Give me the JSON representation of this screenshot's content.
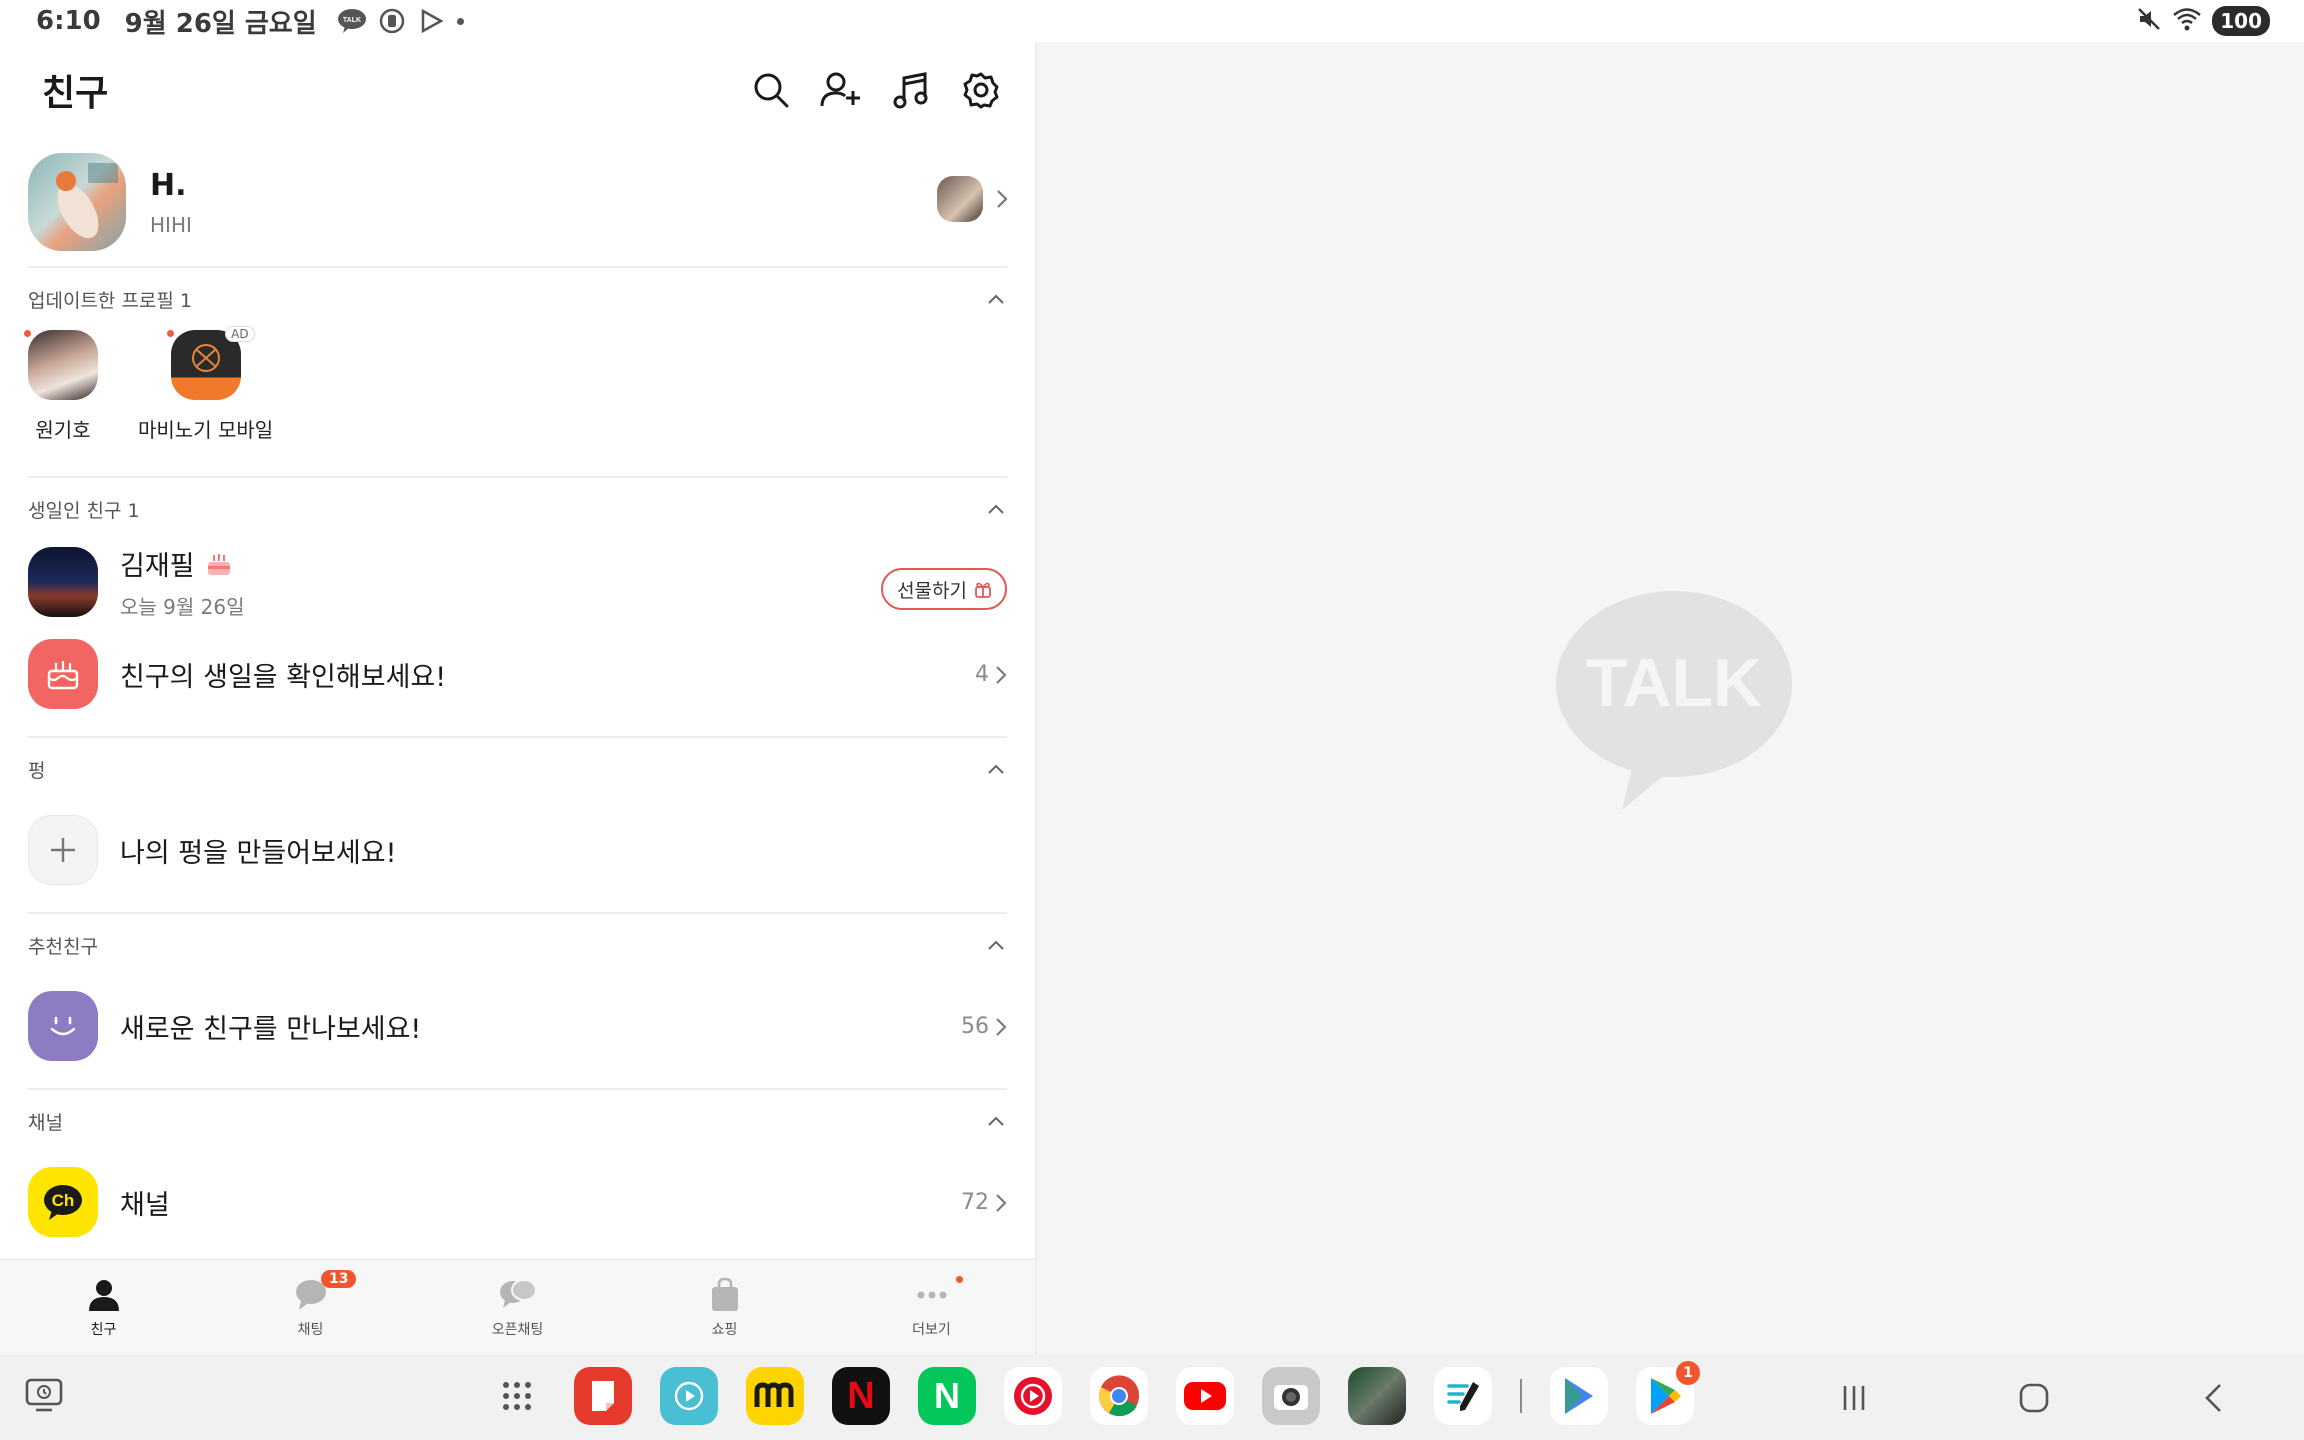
{
  "status_bar": {
    "time": "6:10",
    "date": "9월 26일 금요일",
    "talk_badge": "TALK",
    "battery": "100"
  },
  "header": {
    "title": "친구"
  },
  "profile": {
    "name": "H.",
    "status": "HIHI"
  },
  "sections": {
    "updated": {
      "title": "업데이트한 프로필 1",
      "items": [
        {
          "name": "원기호"
        },
        {
          "name": "마비노기 모바일",
          "badge": "AD"
        }
      ]
    },
    "birthday": {
      "title": "생일인 친구 1",
      "friend": {
        "name": "김재필",
        "date": "오늘 9월 26일",
        "gift_label": "선물하기"
      },
      "check": {
        "label": "친구의 생일을 확인해보세요!",
        "count": "4"
      }
    },
    "pyeong": {
      "title": "펑",
      "create_label": "나의 펑을 만들어보세요!"
    },
    "recommend": {
      "title": "추천친구",
      "label": "새로운 친구를 만나보세요!",
      "count": "56"
    },
    "channel": {
      "title": "채널",
      "label": "채널",
      "icon_text": "Ch",
      "count": "72"
    }
  },
  "bottom_nav": {
    "items": [
      {
        "label": "친구"
      },
      {
        "label": "채팅",
        "badge": "13"
      },
      {
        "label": "오픈채팅"
      },
      {
        "label": "쇼핑"
      },
      {
        "label": "더보기"
      }
    ]
  },
  "right_pane": {
    "logo_text": "TALK"
  },
  "taskbar": {
    "apps": [
      {
        "name": "app-drawer"
      },
      {
        "name": "notes"
      },
      {
        "name": "player"
      },
      {
        "name": "market"
      },
      {
        "name": "netflix",
        "text": "N"
      },
      {
        "name": "naver",
        "text": "N"
      },
      {
        "name": "music"
      },
      {
        "name": "chrome"
      },
      {
        "name": "youtube"
      },
      {
        "name": "camera"
      },
      {
        "name": "game"
      },
      {
        "name": "pen"
      },
      {
        "name": "play-store"
      },
      {
        "name": "play-store-badge",
        "badge": "1"
      }
    ]
  },
  "colors": {
    "accent_red": "#f2552c",
    "kakao_yellow": "#fee500",
    "birthday_red": "#f26563",
    "recommend_purple": "#8e7cc3"
  }
}
